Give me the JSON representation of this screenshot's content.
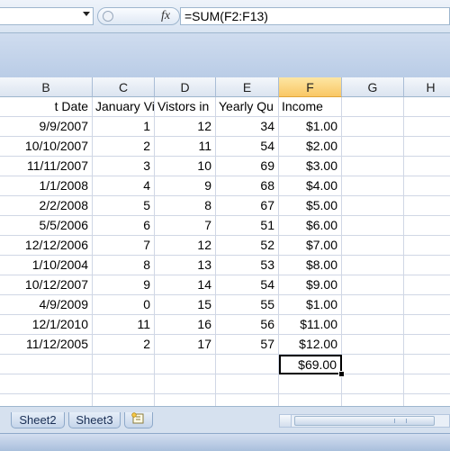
{
  "formula_bar": {
    "fx_label": "fx",
    "formula": "=SUM(F2:F13)"
  },
  "columns": [
    {
      "id": "B",
      "header": "B"
    },
    {
      "id": "C",
      "header": "C"
    },
    {
      "id": "D",
      "header": "D"
    },
    {
      "id": "E",
      "header": "E"
    },
    {
      "id": "F",
      "header": "F",
      "active": true
    },
    {
      "id": "G",
      "header": "G"
    },
    {
      "id": "H",
      "header": "H"
    }
  ],
  "header_row": [
    "t Date",
    "January Vi",
    "Vistors in",
    "Yearly Qu",
    "Income"
  ],
  "rows": [
    [
      "9/9/2007",
      "1",
      "12",
      "34",
      "$1.00"
    ],
    [
      "10/10/2007",
      "2",
      "11",
      "54",
      "$2.00"
    ],
    [
      "11/11/2007",
      "3",
      "10",
      "69",
      "$3.00"
    ],
    [
      "1/1/2008",
      "4",
      "9",
      "68",
      "$4.00"
    ],
    [
      "2/2/2008",
      "5",
      "8",
      "67",
      "$5.00"
    ],
    [
      "5/5/2006",
      "6",
      "7",
      "51",
      "$6.00"
    ],
    [
      "12/12/2006",
      "7",
      "12",
      "52",
      "$7.00"
    ],
    [
      "1/10/2004",
      "8",
      "13",
      "53",
      "$8.00"
    ],
    [
      "10/12/2007",
      "9",
      "14",
      "54",
      "$9.00"
    ],
    [
      "4/9/2009",
      "0",
      "15",
      "55",
      "$1.00"
    ],
    [
      "12/1/2010",
      "11",
      "16",
      "56",
      "$11.00"
    ],
    [
      "11/12/2005",
      "2",
      "17",
      "57",
      "$12.00"
    ]
  ],
  "total_cell": "$69.00",
  "sheet_tabs": [
    "Sheet2",
    "Sheet3"
  ],
  "colors": {
    "accent_header": "#f9c764",
    "grid_line": "#d0d7e5",
    "chrome": "#dbe5f3"
  }
}
